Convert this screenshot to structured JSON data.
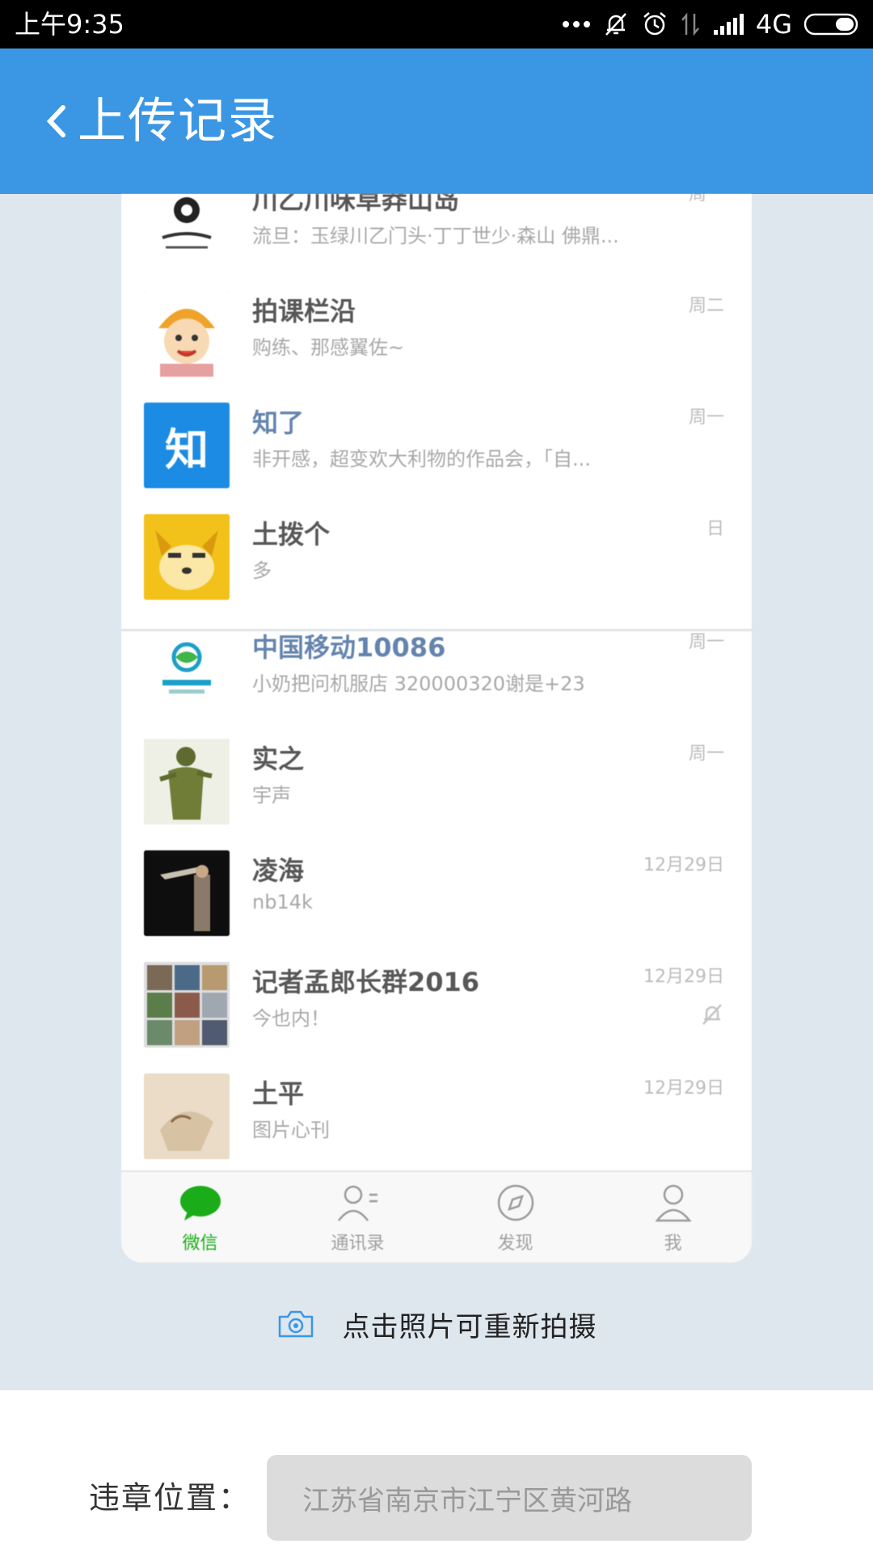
{
  "status_bar": {
    "time": "上午9:35",
    "network": "4G"
  },
  "header": {
    "title": "上传记录"
  },
  "photo": {
    "chats": [
      {
        "name": "川乙川味草莽山岛",
        "preview": "流旦：玉绿川乙门头·丁丁世少·森山 佛鼎...",
        "time": "周一",
        "avatar": "ink",
        "avatar_color": "#ffffff"
      },
      {
        "name": "拍课栏沿",
        "preview": "购练、那感翼佐~",
        "time": "周二",
        "avatar": "cartoon",
        "avatar_color": "#f3a82b"
      },
      {
        "name": "知了",
        "preview": "非开感，超变欢大利物的作品会，「自...",
        "time": "周一",
        "avatar": "知",
        "avatar_color": "#1b8be3"
      },
      {
        "name": "土拨个",
        "preview": "多",
        "time": "日",
        "avatar": "shiba",
        "avatar_color": "#f2c21a"
      },
      {
        "name": "中国移动10086",
        "preview": "小奶把问机服店 320000320谢是+23",
        "time": "周一",
        "avatar": "cmcc",
        "avatar_color": "#ffffff"
      },
      {
        "name": "实之",
        "preview": "宇声",
        "time": "周一",
        "avatar": "statue",
        "avatar_color": "#7a8a46"
      },
      {
        "name": "凌海",
        "preview": "nb14k",
        "time": "12月29日",
        "avatar": "dark",
        "avatar_color": "#111111"
      },
      {
        "name": "记者孟郎长群2016",
        "preview": "今也内！",
        "time": "12月29日",
        "avatar": "grid",
        "avatar_color": "#9aa08a",
        "muted": true
      },
      {
        "name": "土平",
        "preview": "图片心刊",
        "time": "12月29日",
        "avatar": "sketch",
        "avatar_color": "#e6d6bd"
      }
    ],
    "tabs": [
      {
        "label": "微信",
        "icon": "chat-bubble-icon"
      },
      {
        "label": "通讯录",
        "icon": "contacts-icon"
      },
      {
        "label": "发现",
        "icon": "compass-icon"
      },
      {
        "label": "我",
        "icon": "person-icon"
      }
    ],
    "retake_text": "点击照片可重新拍摄"
  },
  "form": {
    "location_label": "违章位置：",
    "location_value": "江苏省南京市江宁区黄河路"
  },
  "colors": {
    "header": "#3b97e3",
    "photo_bg": "#dee6ee",
    "wechat_green": "#1aad19"
  }
}
